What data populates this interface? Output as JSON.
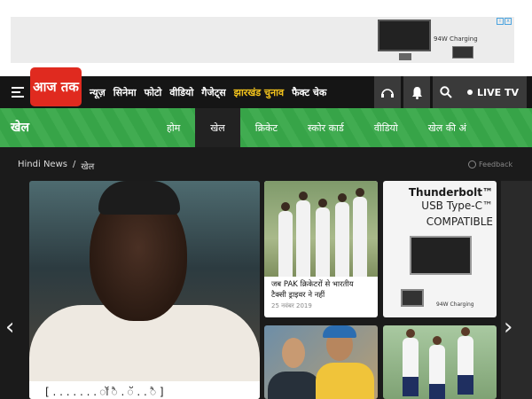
{
  "ad_top": {
    "text": "94W Charging",
    "close_glyphs": [
      "i",
      "x"
    ]
  },
  "header": {
    "logo_text": "आज तक",
    "nav": [
      "न्यूज़",
      "सिनेमा",
      "फोटो",
      "वीडियो",
      "गैजेट्स",
      "झारखंड चुनाव",
      "फैक्ट चेक"
    ],
    "nav_highlight_index": 5,
    "nav_highlight_color": "#f3c31c",
    "live_tv": "LIVE TV"
  },
  "section": {
    "title": "खेल",
    "tabs": [
      "होम",
      "खेल",
      "क्रिकेट",
      "स्कोर कार्ड",
      "वीडियो",
      "खेल की अं"
    ],
    "active_tab_index": 1,
    "accent": "#39a94a"
  },
  "breadcrumb": {
    "home": "Hindi News",
    "separator": "/",
    "current": "खेल"
  },
  "feedback": "Feedback",
  "main_story": {
    "caption": "[ . . . . . . . ॉ ै . ॅ . . ै ]"
  },
  "card_story": {
    "title": "जब PAK क्रिकेटरों से भारतीय टैक्सी ड्राइवर ने नहीं",
    "date": "25 नवंबर 2019"
  },
  "ad_card": {
    "line1": "Thunderbolt™",
    "line2": "USB Type-C™",
    "line3": "COMPATIBLE",
    "small": "94W Charging"
  },
  "arrows": {
    "left": "‹",
    "right": "›"
  }
}
